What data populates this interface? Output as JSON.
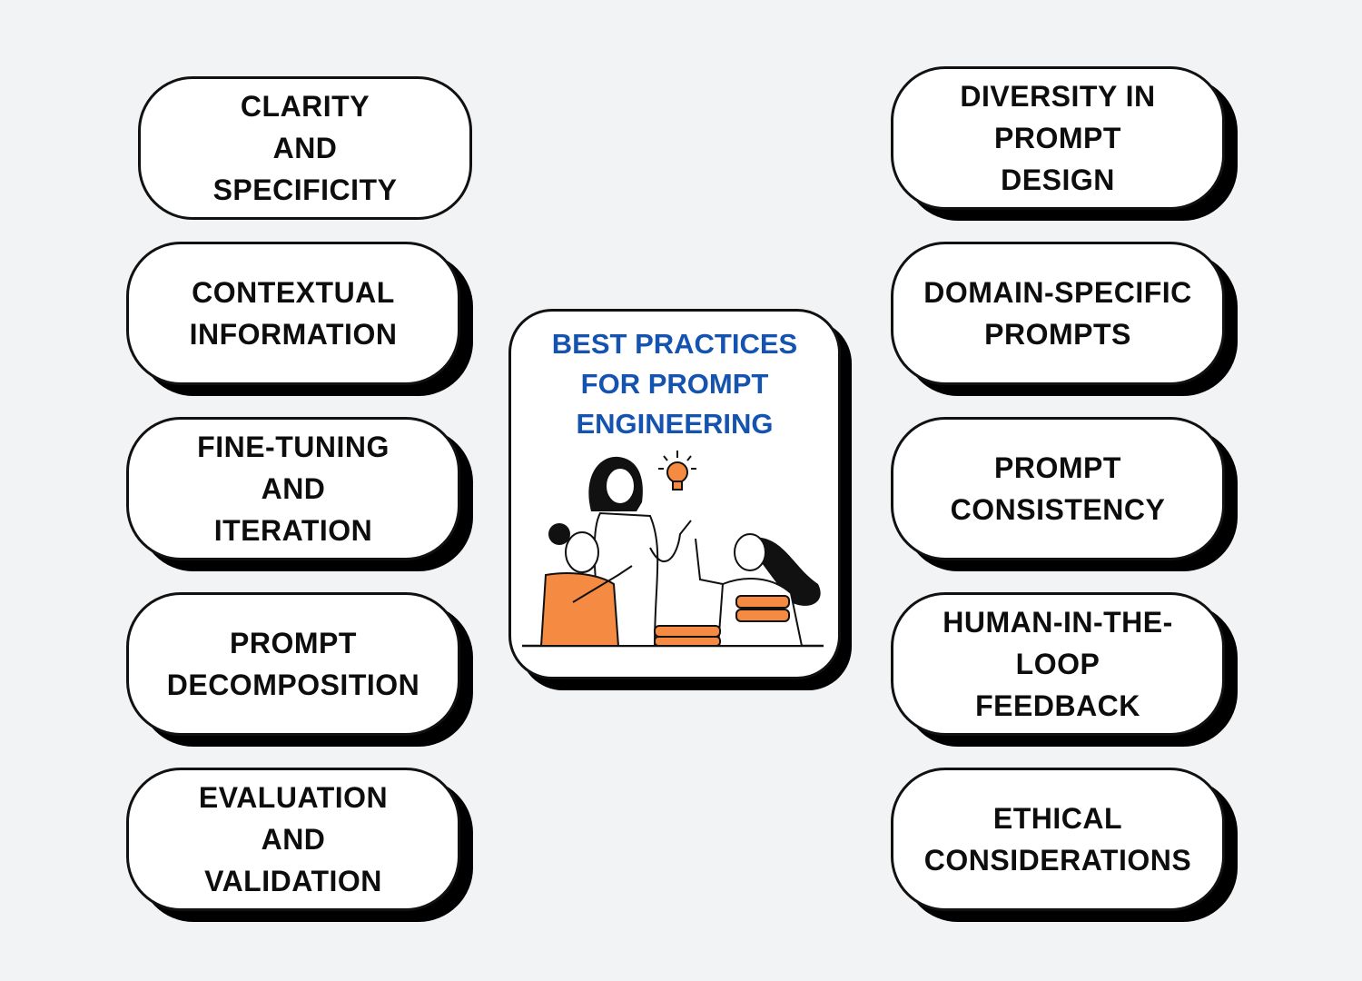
{
  "title": "BEST PRACTICES\nFOR PROMPT\nENGINEERING",
  "colors": {
    "background": "#f2f3f5",
    "title_blue": "#1553b0",
    "accent_orange": "#f58a42",
    "text": "#0d0d0d"
  },
  "left_items": [
    {
      "label": "CLARITY\nAND\nSPECIFICITY"
    },
    {
      "label": "CONTEXTUAL\nINFORMATION"
    },
    {
      "label": "FINE-TUNING\nAND\nITERATION"
    },
    {
      "label": "PROMPT\nDECOMPOSITION"
    },
    {
      "label": "EVALUATION\nAND\nVALIDATION"
    }
  ],
  "right_items": [
    {
      "label": "DIVERSITY IN\nPROMPT\nDESIGN"
    },
    {
      "label": "DOMAIN-SPECIFIC\nPROMPTS"
    },
    {
      "label": "PROMPT\nCONSISTENCY"
    },
    {
      "label": "HUMAN-IN-THE-\nLOOP\nFEEDBACK"
    },
    {
      "label": "ETHICAL\nCONSIDERATIONS"
    }
  ],
  "illustration": {
    "icon": "people-collaborating-lightbulb-illustration"
  }
}
